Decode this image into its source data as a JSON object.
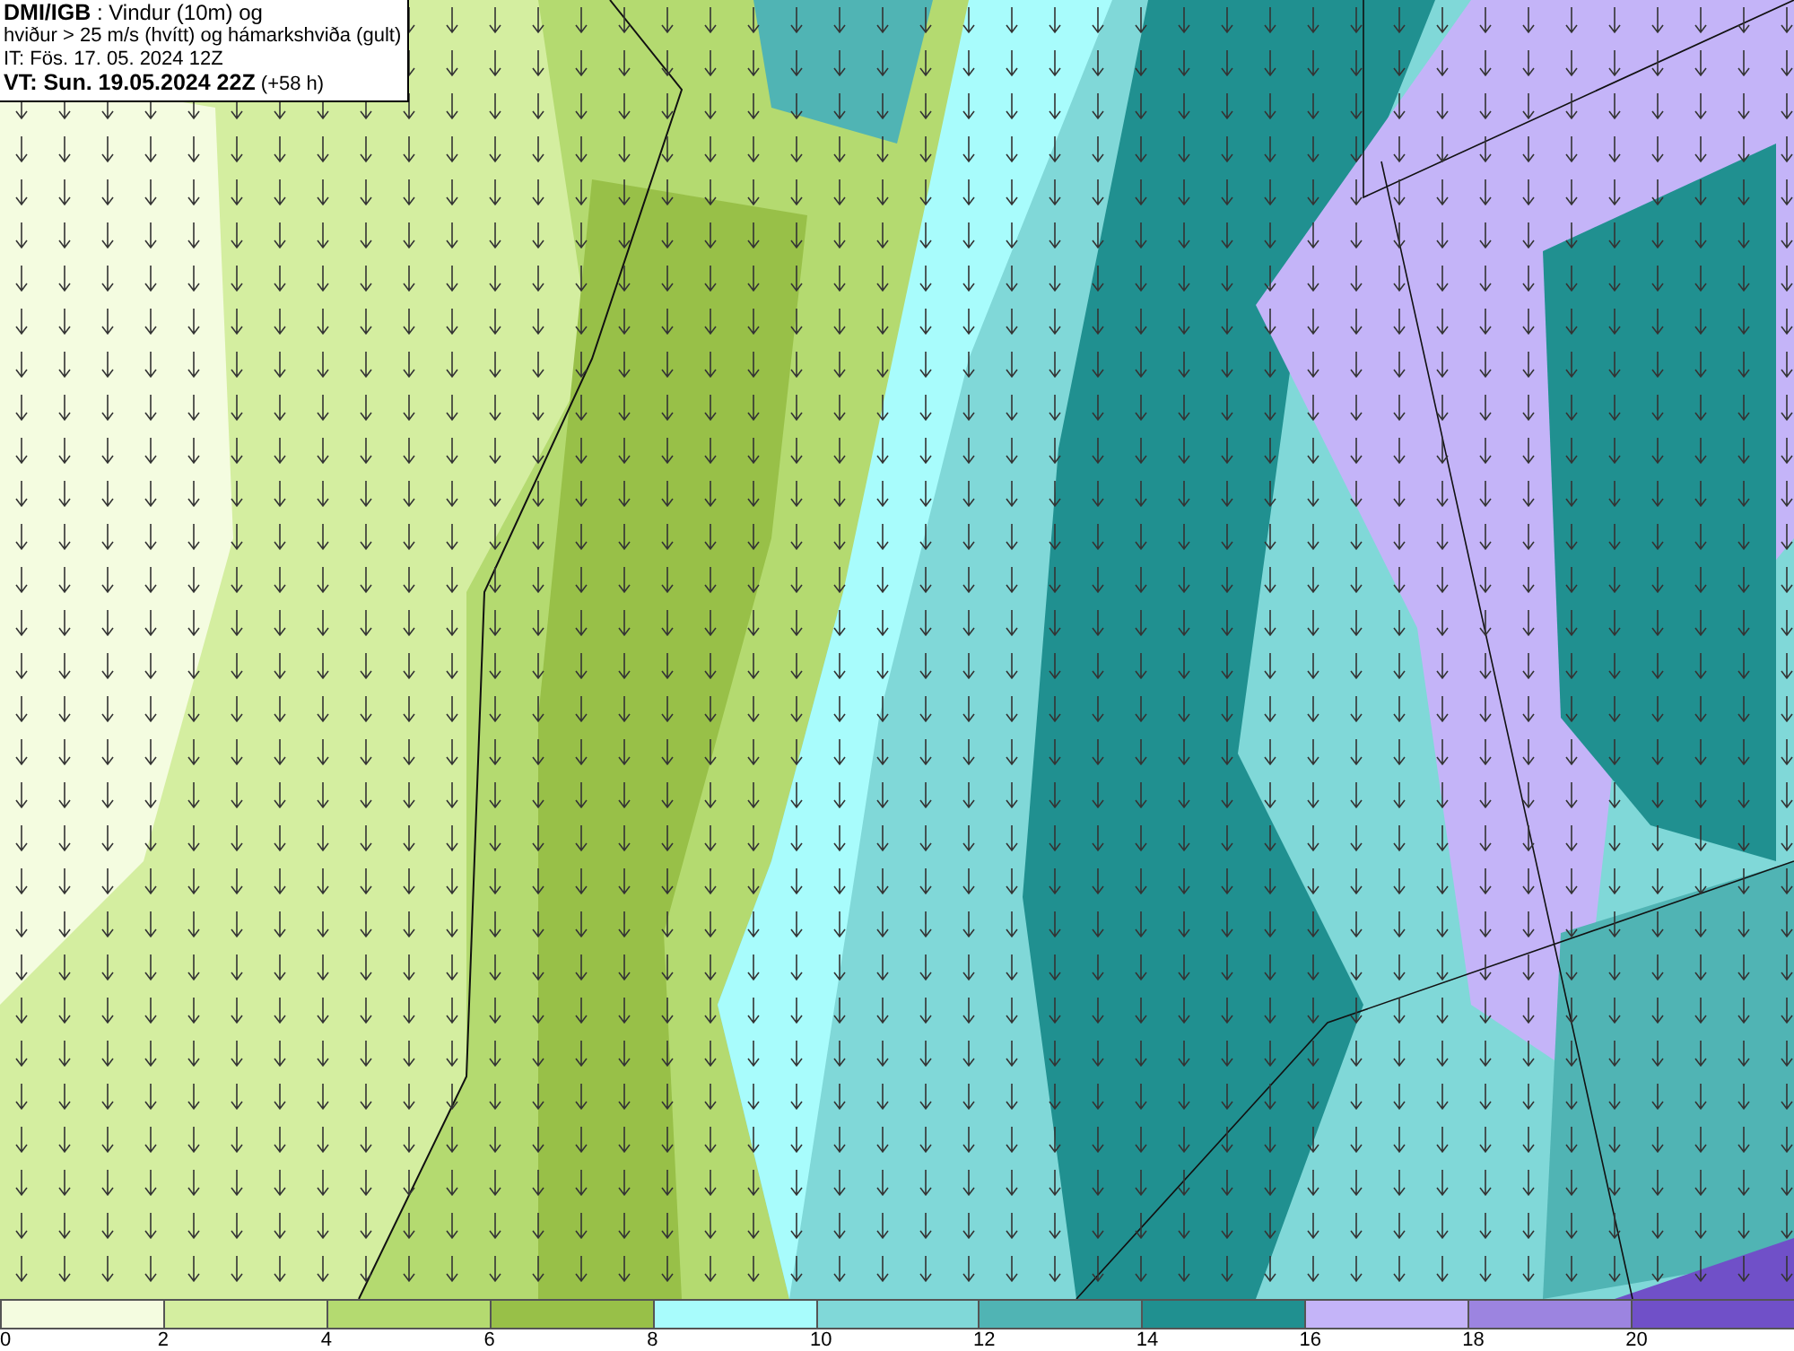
{
  "title_box": {
    "lines": [
      "**DMI/IGB** : Vindur (10m) og",
      "hviður > 25 m/s (hvítt) og hámarkshviða (gult)",
      "IT: Fös. 17. 05. 2024 12Z",
      "**VT: Sun. 19.05.2024 22Z** (+58 h)"
    ]
  },
  "legend": [
    {
      "label": "0",
      "color": "#f4fce0"
    },
    {
      "label": "2",
      "color": "#d4eea0"
    },
    {
      "label": "4",
      "color": "#b4da70"
    },
    {
      "label": "6",
      "color": "#98c048"
    },
    {
      "label": "8",
      "color": "#a8fcfc"
    },
    {
      "label": "10",
      "color": "#80d8d8"
    },
    {
      "label": "12",
      "color": "#50b4b4"
    },
    {
      "label": "14",
      "color": "#209090"
    },
    {
      "label": "16",
      "color": "#c4b4f8"
    },
    {
      "label": "18",
      "color": "#9c84e0"
    },
    {
      "label": "20",
      "color": "#7050c8"
    }
  ]
}
